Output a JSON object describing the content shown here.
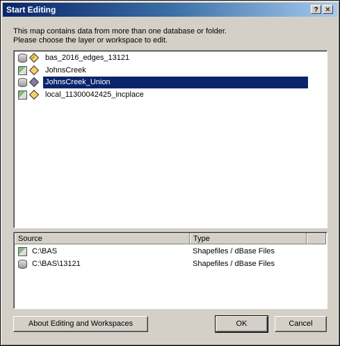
{
  "window": {
    "title": "Start Editing",
    "help_glyph": "?",
    "close_glyph": "✕"
  },
  "instructions": "This map contains data from more than one database or folder.\nPlease choose the layer or workspace to edit.",
  "layers": [
    {
      "label": "bas_2016_edges_13121",
      "workspace_icon": "database-icon",
      "layer_icon": "line-layer-icon",
      "selected": false
    },
    {
      "label": "JohnsCreek",
      "workspace_icon": "folder-icon",
      "layer_icon": "polygon-layer-icon",
      "selected": false
    },
    {
      "label": "JohnsCreek_Union",
      "workspace_icon": "database-icon",
      "layer_icon": "polygon-layer-icon",
      "selected": true
    },
    {
      "label": "local_11300042425_incplace",
      "workspace_icon": "folder-icon",
      "layer_icon": "polygon-layer-icon",
      "selected": false
    }
  ],
  "workspaces": {
    "columns": [
      "Source",
      "Type"
    ],
    "rows": [
      {
        "source": "C:\\BAS",
        "type": "Shapefiles / dBase Files",
        "icon": "folder-icon"
      },
      {
        "source": "C:\\BAS\\13121",
        "type": "Shapefiles / dBase Files",
        "icon": "database-icon"
      }
    ]
  },
  "buttons": {
    "about": "About Editing and Workspaces",
    "ok": "OK",
    "cancel": "Cancel"
  },
  "colors": {
    "title_bar": "#0a246a",
    "selection": "#0a246a",
    "dialog_face": "#d4d0c8"
  }
}
